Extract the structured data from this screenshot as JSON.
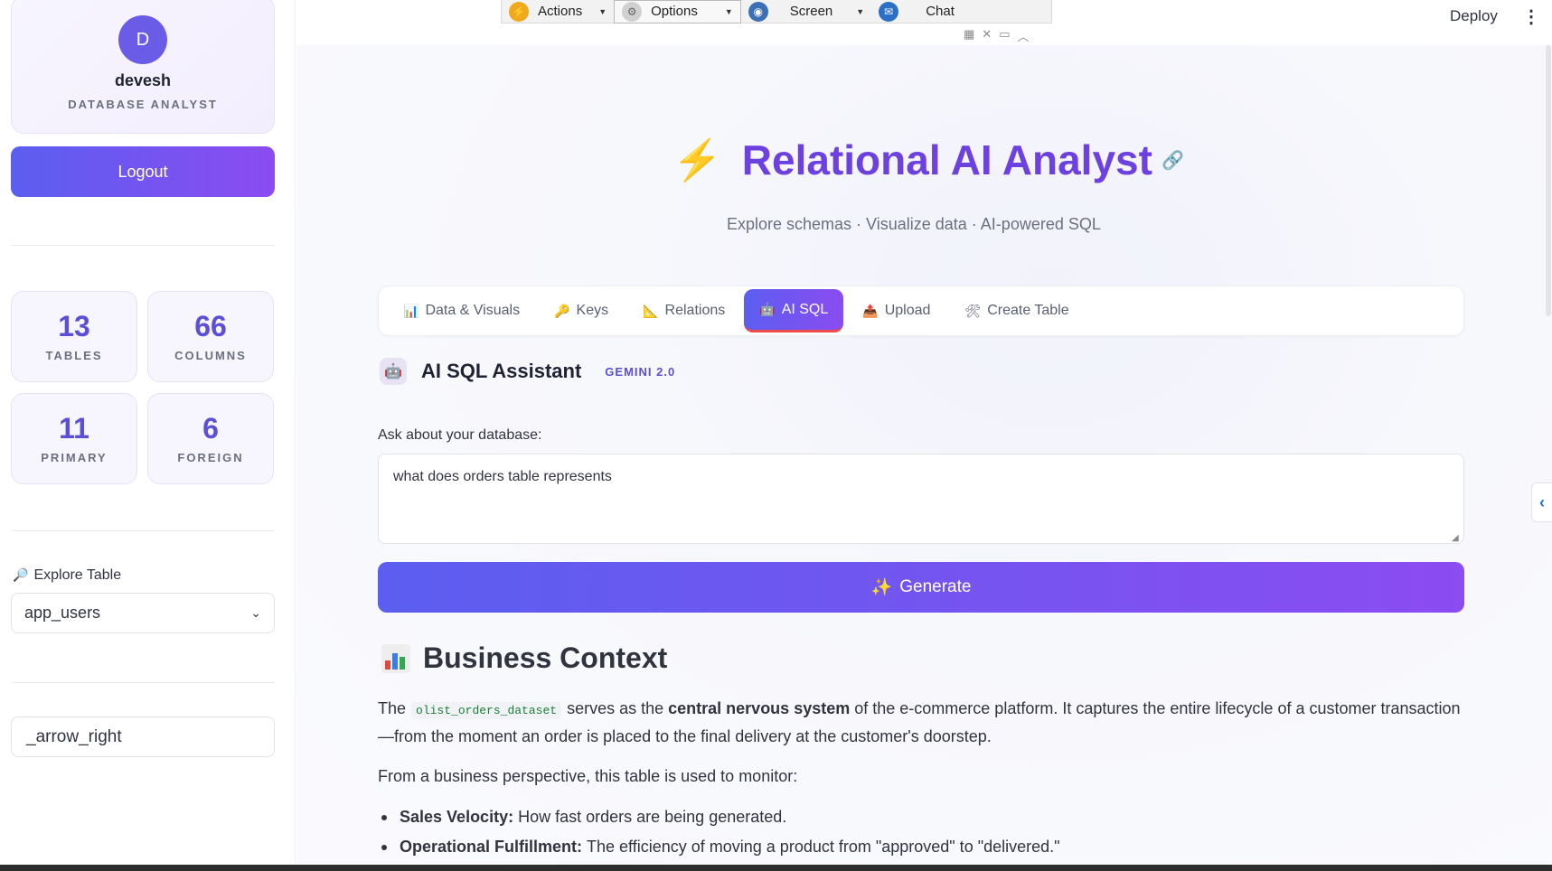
{
  "sidebar": {
    "avatar_letter": "D",
    "username": "devesh",
    "role": "DATABASE ANALYST",
    "logout_label": "Logout",
    "stats": [
      {
        "value": "13",
        "label": "TABLES"
      },
      {
        "value": "66",
        "label": "COLUMNS"
      },
      {
        "value": "11",
        "label": "PRIMARY"
      },
      {
        "value": "6",
        "label": "FOREIGN"
      }
    ],
    "explore_label": "Explore Table",
    "explore_icon": "magnifier-icon",
    "selected_table": "app_users",
    "expander_text": "_arrow_right"
  },
  "toolbar": {
    "actions_label": "Actions",
    "options_label": "Options",
    "screen_label": "Screen",
    "chat_label": "Chat"
  },
  "header": {
    "deploy_label": "Deploy"
  },
  "main": {
    "title": "Relational AI Analyst",
    "subtitle": "Explore schemas · Visualize data · AI-powered SQL",
    "tabs": [
      {
        "label": "Data & Visuals",
        "icon": "📊"
      },
      {
        "label": "Keys",
        "icon": "🔑"
      },
      {
        "label": "Relations",
        "icon": "📐"
      },
      {
        "label": "AI SQL",
        "icon": "🤖"
      },
      {
        "label": "Upload",
        "icon": "📤"
      },
      {
        "label": "Create Table",
        "icon": "🛠"
      }
    ],
    "active_tab": "AI SQL",
    "assistant_title": "AI SQL Assistant",
    "assistant_badge": "GEMINI 2.0",
    "ask_label": "Ask about your database:",
    "ask_value": "what does orders table represents",
    "generate_label": "Generate",
    "business_title": "Business Context",
    "para1_pre": "The",
    "para1_code": "olist_orders_dataset",
    "para1_mid": "serves as the",
    "para1_bold": "central nervous system",
    "para1_post": "of the e-commerce platform. It captures the entire lifecycle of a customer transaction—from the moment an order is placed to the final delivery at the customer's doorstep.",
    "para2": "From a business perspective, this table is used to monitor:",
    "bullets": [
      {
        "bold": "Sales Velocity:",
        "text": "How fast orders are being generated."
      },
      {
        "bold": "Operational Fulfillment:",
        "text": "The efficiency of moving a product from \"approved\" to \"delivered.\""
      }
    ]
  },
  "colors": {
    "accent_start": "#5b5ef0",
    "accent_end": "#8b4cf0",
    "title_purple": "#6d40e0"
  }
}
